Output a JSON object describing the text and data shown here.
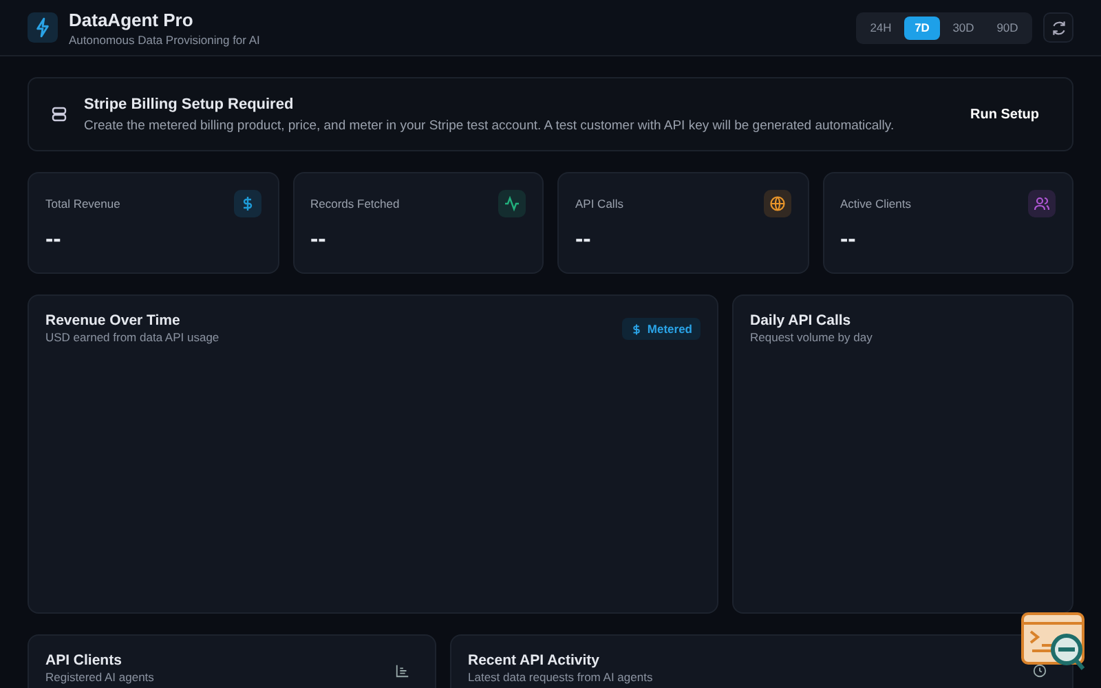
{
  "header": {
    "title": "DataAgent Pro",
    "subtitle": "Autonomous Data Provisioning for AI"
  },
  "ranges": [
    {
      "label": "24H",
      "selected": false
    },
    {
      "label": "7D",
      "selected": true
    },
    {
      "label": "30D",
      "selected": false
    },
    {
      "label": "90D",
      "selected": false
    }
  ],
  "banner": {
    "title": "Stripe Billing Setup Required",
    "text": "Create the metered billing product, price, and meter in your Stripe test account. A test customer with API key will be generated automatically.",
    "button": "Run Setup"
  },
  "stats": [
    {
      "label": "Total Revenue",
      "value": "--",
      "kind": "dollar",
      "color": "#1e9bd7"
    },
    {
      "label": "Records Fetched",
      "value": "--",
      "kind": "pulse",
      "color": "#22b07d"
    },
    {
      "label": "API Calls",
      "value": "--",
      "kind": "globe",
      "color": "#e8952a"
    },
    {
      "label": "Active Clients",
      "value": "--",
      "kind": "users",
      "color": "#b157d6"
    }
  ],
  "charts": [
    {
      "title": "Revenue Over Time",
      "subtitle": "USD earned from data API usage",
      "badge": "Metered"
    },
    {
      "title": "Daily API Calls",
      "subtitle": "Request volume by day"
    }
  ],
  "panels": [
    {
      "title": "API Clients",
      "subtitle": "Registered AI agents",
      "kind": "chart"
    },
    {
      "title": "Recent API Activity",
      "subtitle": "Latest data requests from AI agents",
      "kind": "clock"
    }
  ]
}
